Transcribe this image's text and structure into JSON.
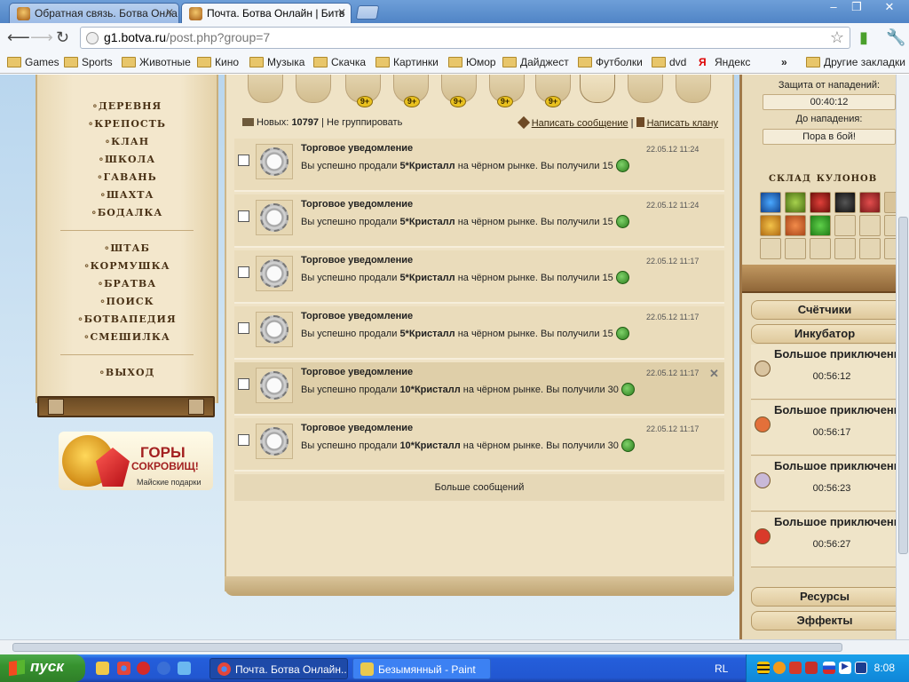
{
  "browser": {
    "tabs": [
      {
        "title": "Обратная связь. Ботва Онла",
        "active": false
      },
      {
        "title": "Почта. Ботва Онлайн | Битв",
        "active": true
      }
    ],
    "url_host": "g1.botva.ru",
    "url_path": "/post.php?group=7",
    "bookmarks": [
      "Games",
      "Sports",
      "Животные",
      "Кино",
      "Музыка",
      "Скачка",
      "Картинки",
      "Юмор",
      "Дайджест",
      "Футболки",
      "dvd",
      "Яндекс"
    ],
    "bookmarks_more": "»",
    "other_bookmarks": "Другие закладки"
  },
  "left_menu": {
    "group1": [
      "деревня",
      "крепость",
      "клан",
      "школа",
      "гавань",
      "шахта",
      "бодалка"
    ],
    "group2": [
      "штаб",
      "кормушка",
      "братва",
      "поиск",
      "ботвапедия",
      "смешилка"
    ],
    "group3": [
      "выход"
    ]
  },
  "ad": {
    "line1": "ГОРЫ",
    "line2": "СОКРОВИЩ!",
    "line3": "Майские подарки"
  },
  "top_icons": {
    "badges": [
      "9+",
      "9+",
      "9+",
      "9+",
      "9+"
    ]
  },
  "mail": {
    "new_label": "Новых:",
    "new_count": "10797",
    "separator": "|",
    "ungroup": "Не группировать",
    "write_message": "Написать сообщение",
    "write_clan": "Написать клану",
    "messages": [
      {
        "subject": "Торговое уведомление",
        "date": "22.05.12 11:24",
        "pre": "Вы успешно продали ",
        "item": "5*Кристалл",
        "post": " на чёрном рынке. Вы получили 15"
      },
      {
        "subject": "Торговое уведомление",
        "date": "22.05.12 11:24",
        "pre": "Вы успешно продали ",
        "item": "5*Кристалл",
        "post": " на чёрном рынке. Вы получили 15"
      },
      {
        "subject": "Торговое уведомление",
        "date": "22.05.12 11:17",
        "pre": "Вы успешно продали ",
        "item": "5*Кристалл",
        "post": " на чёрном рынке. Вы получили 15"
      },
      {
        "subject": "Торговое уведомление",
        "date": "22.05.12 11:17",
        "pre": "Вы успешно продали ",
        "item": "5*Кристалл",
        "post": " на чёрном рынке. Вы получили 15"
      },
      {
        "subject": "Торговое уведомление",
        "date": "22.05.12 11:17",
        "pre": "Вы успешно продали ",
        "item": "10*Кристалл",
        "post": " на чёрном рынке. Вы получили 30"
      },
      {
        "subject": "Торговое уведомление",
        "date": "22.05.12 11:17",
        "pre": "Вы успешно продали ",
        "item": "10*Кристалл",
        "post": " на чёрном рынке. Вы получили 30"
      }
    ],
    "more": "Больше сообщений"
  },
  "right_panel": {
    "protect_label": "Защита от нападений:",
    "protect_value": "00:40:12",
    "attack_label": "До нападения:",
    "attack_value": "Пора в бой!",
    "warehouse_title": "склад кулонов",
    "sections": {
      "counters": "Счётчики",
      "incubator": "Инкубатор",
      "resources": "Ресурсы",
      "effects": "Эффекты"
    },
    "incubator": [
      {
        "name": "Большое приключение",
        "time": "00:56:12"
      },
      {
        "name": "Большое приключение",
        "time": "00:56:17"
      },
      {
        "name": "Большое приключение",
        "time": "00:56:23"
      },
      {
        "name": "Большое приключение",
        "time": "00:56:27"
      }
    ]
  },
  "taskbar": {
    "start": "пуск",
    "windows": [
      "Почта. Ботва Онлайн...",
      "Безымянный - Paint"
    ],
    "lang": "RL",
    "clock": "8:08"
  }
}
